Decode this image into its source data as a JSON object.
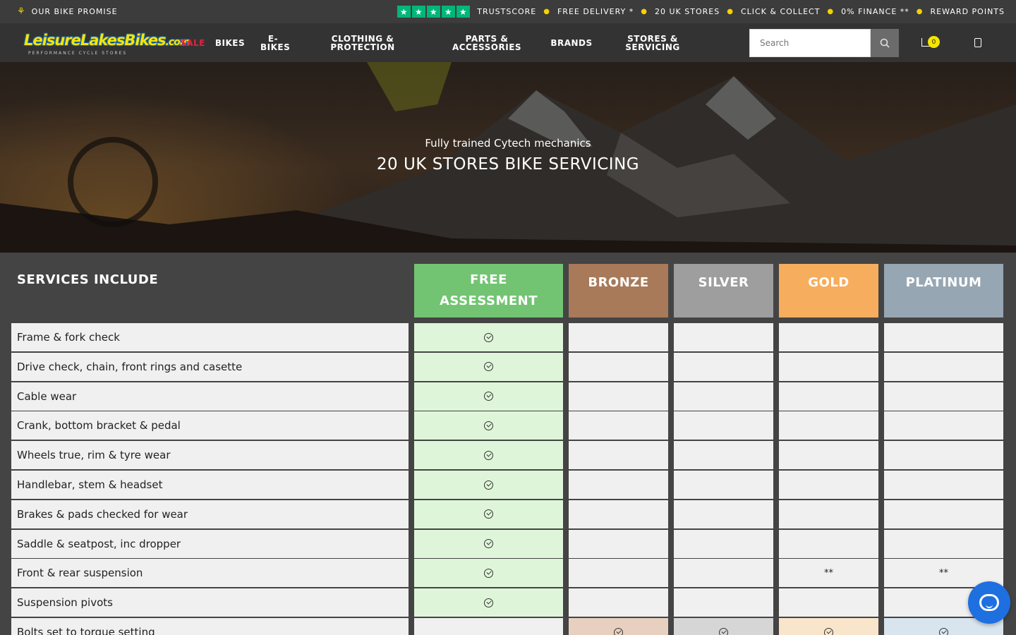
{
  "topbar": {
    "promise": "OUR BIKE PROMISE",
    "trustscore": "TRUSTSCORE",
    "items": [
      "FREE DELIVERY *",
      "20 UK STORES",
      "CLICK & COLLECT",
      "0% FINANCE **",
      "REWARD POINTS"
    ],
    "star_color": "#00b67a"
  },
  "nav": {
    "logo": {
      "main": "LeisureLakesBikes",
      "suffix": ".com",
      "sub": "PERFORMANCE CYCLE STORES"
    },
    "items": [
      {
        "label": "SALE",
        "color": "#e0233f"
      },
      {
        "label": "BIKES"
      },
      {
        "label": "E-BIKES"
      },
      {
        "label": "CLOTHING & PROTECTION"
      },
      {
        "label": "PARTS & ACCESSORIES"
      },
      {
        "label": "BRANDS"
      },
      {
        "label": "STORES & SERVICING"
      }
    ],
    "search": {
      "placeholder": "Search"
    },
    "cart_count": "0",
    "icons": {
      "search": "search-icon",
      "cart": "cart-icon",
      "user": "user-icon"
    }
  },
  "hero": {
    "subtitle": "Fully trained Cytech mechanics",
    "title": "20 UK STORES BIKE SERVICING"
  },
  "table": {
    "heading": "SERVICES INCLUDE",
    "columns": [
      {
        "label": "FREE ASSESSMENT",
        "header_color": "#72c472",
        "cell_color": "#dff5d9"
      },
      {
        "label": "BRONZE",
        "header_color": "#a87a5a",
        "cell_color": "#e8d0c0"
      },
      {
        "label": "SILVER",
        "header_color": "#9e9e9e",
        "cell_color": "#d6d6d6"
      },
      {
        "label": "GOLD",
        "header_color": "#f6ad5e",
        "cell_color": "#f8e5cc"
      },
      {
        "label": "PLATINUM",
        "header_color": "#97a6b3",
        "cell_color": "#d8e4ee"
      }
    ],
    "rows": [
      {
        "label": "Frame & fork check",
        "cells": [
          "check",
          "",
          "",
          "",
          ""
        ]
      },
      {
        "label": "Drive check, chain, front rings and casette",
        "cells": [
          "check",
          "",
          "",
          "",
          ""
        ]
      },
      {
        "label": "Cable wear",
        "cells": [
          "check",
          "",
          "",
          "",
          ""
        ]
      },
      {
        "label": "Crank, bottom bracket & pedal",
        "cells": [
          "check",
          "",
          "",
          "",
          ""
        ]
      },
      {
        "label": "Wheels true, rim & tyre wear",
        "cells": [
          "check",
          "",
          "",
          "",
          ""
        ]
      },
      {
        "label": "Handlebar, stem & headset",
        "cells": [
          "check",
          "",
          "",
          "",
          ""
        ]
      },
      {
        "label": "Brakes & pads checked for wear",
        "cells": [
          "check",
          "",
          "",
          "",
          ""
        ]
      },
      {
        "label": "Saddle & seatpost, inc dropper",
        "cells": [
          "check",
          "",
          "",
          "",
          ""
        ]
      },
      {
        "label": "Front & rear suspension",
        "cells": [
          "check",
          "",
          "",
          "**",
          "**"
        ]
      },
      {
        "label": "Suspension pivots",
        "cells": [
          "check",
          "",
          "",
          "",
          ""
        ]
      },
      {
        "label": "Bolts set to torque setting",
        "cells": [
          "",
          "check",
          "check",
          "check",
          "check"
        ]
      }
    ]
  },
  "chat": {
    "icon": "chat-icon"
  }
}
